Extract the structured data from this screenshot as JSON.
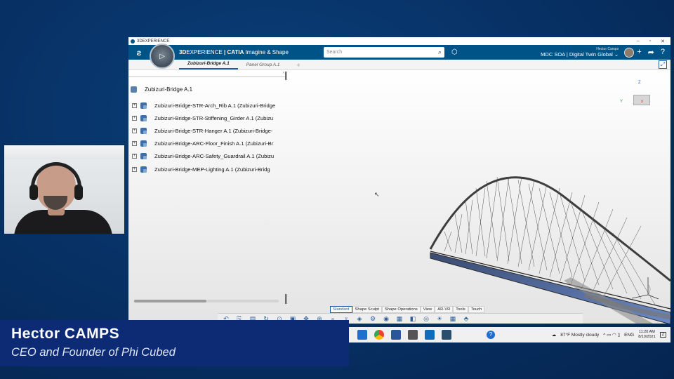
{
  "presenter": {
    "name": "Hector CAMPS",
    "title": "CEO and Founder of Phi Cubed"
  },
  "window": {
    "title": "3DEXPERIENCE",
    "controls": [
      "–",
      "▫",
      "✕"
    ]
  },
  "topbar": {
    "brand_prefix": "3D",
    "brand_bold": "EXPERIENCE",
    "brand_app": " | CATIA",
    "brand_suffix": " Imagine & Shape",
    "compass_center": "▷",
    "search_placeholder": "Search",
    "user_name": "Hector Camps",
    "collab_space": "MDC SOA | Digital Twin Global ⌄"
  },
  "tabs": [
    {
      "label": "Zubizuri-Bridge A.1",
      "active": true
    },
    {
      "label": "Panel Group A.1",
      "active": false
    },
    {
      "label": "+",
      "active": false
    }
  ],
  "tree": {
    "root": "Zubizuri-Bridge A.1",
    "items": [
      "Zubizuri-Bridge-STR-Arch_Rib A.1 (Zubizuri-Bridge",
      "Zubizuri-Bridge-STR-Stiffening_Girder A.1 (Zubizu",
      "Zubizuri-Bridge-STR-Hanger A.1 (Zubizuri-Bridge-",
      "Zubizuri-Bridge-ARC-Floor_Finish A.1 (Zubizuri-Br",
      "Zubizuri-Bridge-ARC-Safety_Guardrail A.1 (Zubizu",
      "Zubizuri-Bridge-MEP-Lighting A.1 (Zubizuri-Bridg"
    ],
    "scroll_position": 0.5
  },
  "compass3d": {
    "z": "Z",
    "y": "Y",
    "x": "x"
  },
  "action_tabs": [
    {
      "label": "Standard",
      "active": true
    },
    {
      "label": "Shape Sculpt",
      "active": false
    },
    {
      "label": "Shape Operations",
      "active": false
    },
    {
      "label": "View",
      "active": false
    },
    {
      "label": "AR-VR",
      "active": false
    },
    {
      "label": "Tools",
      "active": false
    },
    {
      "label": "Touch",
      "active": false
    }
  ],
  "action_icons": [
    "move-icon",
    "zoom-icon",
    "pan-icon",
    "view-icon",
    "render-icon",
    "settings-icon",
    "cube-icon",
    "grid-icon"
  ],
  "taskbar": {
    "weather": "87°F  Mostly cloudy",
    "lang": "ENG",
    "time": "11:20 AM",
    "date": "8/10/2021",
    "notif": "2",
    "help_glyph": "?",
    "tray_glyphs": "^ ▭ ◠ ▯"
  },
  "colors": {
    "background": "#073063",
    "nameplate": "#0d2a74",
    "topbar": "#005386",
    "accent": "#1d5da6"
  }
}
